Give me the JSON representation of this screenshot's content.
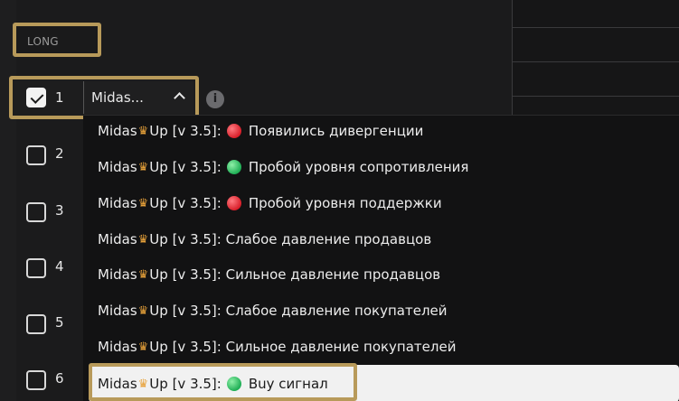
{
  "long_field": {
    "label": "LONG"
  },
  "rows": [
    {
      "number": "1",
      "checked": true
    },
    {
      "number": "2",
      "checked": false
    },
    {
      "number": "3",
      "checked": false
    },
    {
      "number": "4",
      "checked": false
    },
    {
      "number": "5",
      "checked": false
    },
    {
      "number": "6",
      "checked": false
    }
  ],
  "select": {
    "value": "Midas..."
  },
  "options": [
    {
      "prefix": "Midas",
      "suffix": "Up [v 3.5]:",
      "dot": "red",
      "text": "Появились дивергенции"
    },
    {
      "prefix": "Midas",
      "suffix": "Up [v 3.5]:",
      "dot": "green",
      "text": "Пробой уровня сопротивления"
    },
    {
      "prefix": "Midas",
      "suffix": "Up [v 3.5]:",
      "dot": "red",
      "text": "Пробой уровня поддержки"
    },
    {
      "prefix": "Midas",
      "suffix": "Up [v 3.5]:",
      "dot": "",
      "text": "Слабое давление продавцов"
    },
    {
      "prefix": "Midas",
      "suffix": "Up [v 3.5]:",
      "dot": "",
      "text": "Сильное давление продавцов"
    },
    {
      "prefix": "Midas",
      "suffix": "Up [v 3.5]:",
      "dot": "",
      "text": "Слабое давление покупателей"
    },
    {
      "prefix": "Midas",
      "suffix": "Up [v 3.5]:",
      "dot": "",
      "text": "Сильное давление покупателей"
    },
    {
      "prefix": "Midas",
      "suffix": "Up [v 3.5]:",
      "dot": "green",
      "text": "Buy сигнал",
      "selected": true
    }
  ],
  "icons": {
    "crown": "crown-icon",
    "info": "info-icon",
    "chevron": "chevron-up-icon"
  },
  "colors": {
    "highlight": "#b89a5a",
    "red_dot": "#d81f2a",
    "green_dot": "#1fae55"
  }
}
